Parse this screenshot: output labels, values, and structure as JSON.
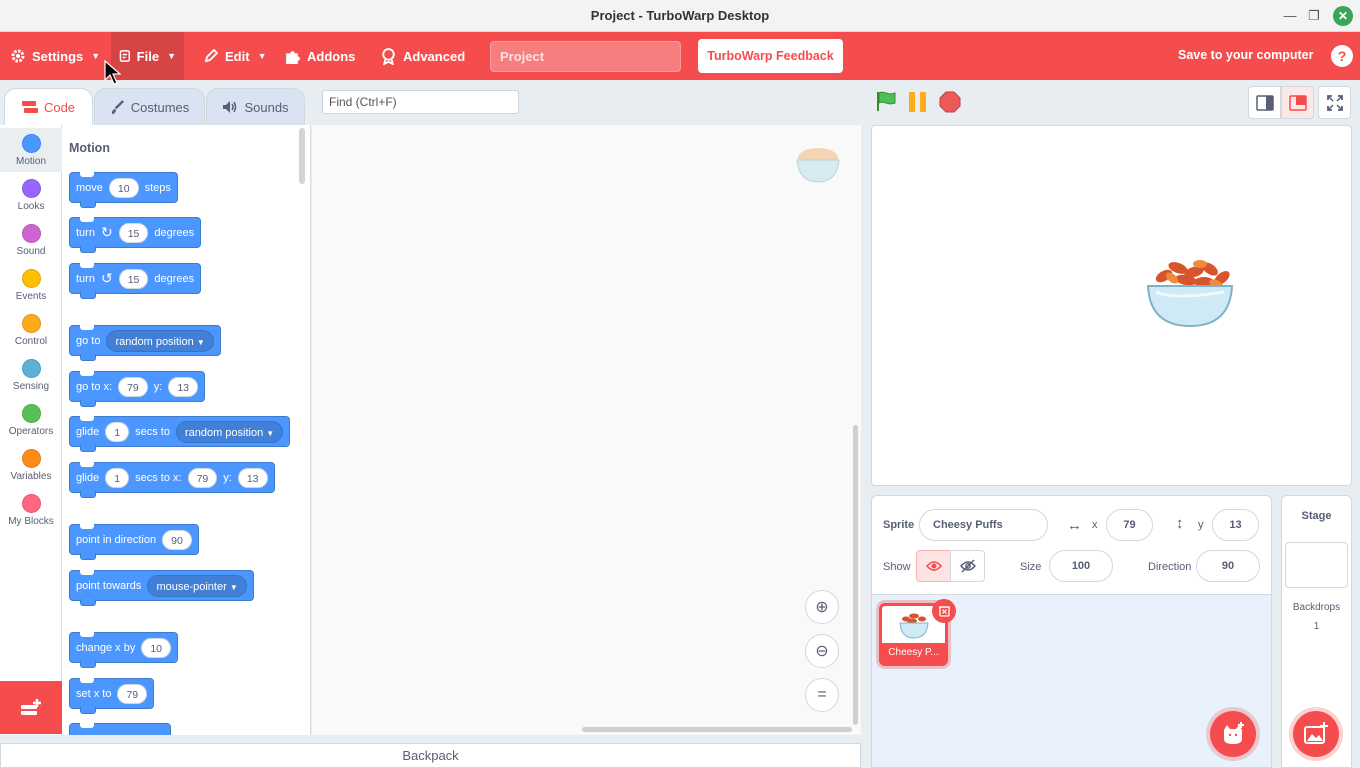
{
  "window": {
    "title": "Project - TurboWarp Desktop"
  },
  "menu": {
    "settings": "Settings",
    "file": "File",
    "edit": "Edit",
    "addons": "Addons",
    "advanced": "Advanced",
    "project_title": "Project",
    "feedback": "TurboWarp Feedback",
    "save": "Save to your computer",
    "help": "?"
  },
  "tabs": {
    "code": "Code",
    "costumes": "Costumes",
    "sounds": "Sounds"
  },
  "find": {
    "placeholder": "Find (Ctrl+F)"
  },
  "categories": [
    {
      "label": "Motion",
      "color": "#4c97ff"
    },
    {
      "label": "Looks",
      "color": "#9966ff"
    },
    {
      "label": "Sound",
      "color": "#cf63cf"
    },
    {
      "label": "Events",
      "color": "#ffbf00"
    },
    {
      "label": "Control",
      "color": "#ffab19"
    },
    {
      "label": "Sensing",
      "color": "#5cb1d6"
    },
    {
      "label": "Operators",
      "color": "#59c059"
    },
    {
      "label": "Variables",
      "color": "#ff8c1a"
    },
    {
      "label": "My Blocks",
      "color": "#ff6680"
    }
  ],
  "palette": {
    "title": "Motion",
    "move": {
      "a": "move",
      "n": "10",
      "b": "steps"
    },
    "turn_right": {
      "a": "turn",
      "n": "15",
      "b": "degrees"
    },
    "turn_left": {
      "a": "turn",
      "n": "15",
      "b": "degrees"
    },
    "goto": {
      "a": "go to",
      "dd": "random position"
    },
    "goto_xy": {
      "a": "go to x:",
      "x": "79",
      "b": "y:",
      "y": "13"
    },
    "glide": {
      "a": "glide",
      "n": "1",
      "b": "secs to",
      "dd": "random position"
    },
    "glide_xy": {
      "a": "glide",
      "n": "1",
      "b": "secs to x:",
      "x": "79",
      "c": "y:",
      "y": "13"
    },
    "point_dir": {
      "a": "point in direction",
      "n": "90"
    },
    "point_towards": {
      "a": "point towards",
      "dd": "mouse-pointer"
    },
    "change_x": {
      "a": "change x by",
      "n": "10"
    },
    "set_x": {
      "a": "set x to",
      "n": "79"
    }
  },
  "backpack": "Backpack",
  "sprite": {
    "label": "Sprite",
    "name": "Cheesy Puffs",
    "x_label": "x",
    "x": "79",
    "y_label": "y",
    "y": "13",
    "show_label": "Show",
    "size_label": "Size",
    "size": "100",
    "direction_label": "Direction",
    "direction": "90",
    "tile_name": "Cheesy P..."
  },
  "stage_panel": {
    "title": "Stage",
    "backdrops_label": "Backdrops",
    "backdrops_count": "1"
  },
  "colors": {
    "accent": "#f54d4d",
    "motion": "#4c97ff"
  }
}
